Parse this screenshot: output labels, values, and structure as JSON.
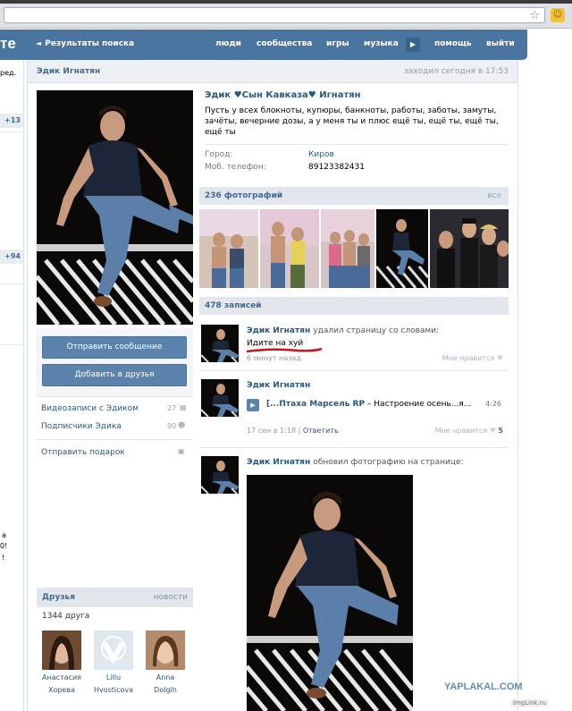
{
  "header": {
    "logo": "те",
    "back_label": "Результаты поиска",
    "nav": [
      "люди",
      "сообщества",
      "игры",
      "музыка",
      "помощь",
      "выйти"
    ]
  },
  "leftcol": {
    "top_text": "ред.",
    "badge1": "+13",
    "badge2": "+94",
    "frag1": "а",
    "frag2": "0!",
    "frag3": "!"
  },
  "profile": {
    "head_name": "Эдик Игнатян",
    "last_seen": "заходил сегодня в 17:53",
    "full_name": "Эдик ♥Сын Кавказа♥ Игнатян",
    "status": "Пусть у всех блокноты, купюры, банкноты, работы, заботы, замуты, зачёты, вечерние дозы, а у меня ты и плюс ещё ты, ещё ты, ещё ты, ещё ты",
    "city_label": "Город:",
    "city_value": "Киров",
    "phone_label": "Моб. телефон:",
    "phone_value": "89123382431"
  },
  "buttons": {
    "message": "Отправить сообщение",
    "add_friend": "Добавить в друзья"
  },
  "menu": {
    "videos": "Видеозаписи с Эдиком",
    "videos_count": "27",
    "subs": "Подписчики Эдика",
    "subs_count": "90",
    "gift": "Отправить подарок"
  },
  "friends": {
    "title": "Друзья",
    "link": "новости",
    "count": "1344 друга",
    "items": [
      {
        "first": "Анастасия",
        "last": "Хорева"
      },
      {
        "first": "Lillu",
        "last": "Hvosticova"
      },
      {
        "first": "Anna",
        "last": "Dolgih"
      }
    ]
  },
  "photos": {
    "title": "236 фотографий",
    "link": "все"
  },
  "wall": {
    "title": "478 записей",
    "posts": [
      {
        "author": "Эдик Игнатян",
        "action": "удалил страницу со словами:",
        "text": "Идите на хуй",
        "time": "6 минут назад",
        "like": "Мне нравится"
      },
      {
        "author": "Эдик Игнатян",
        "audio_title": "[...Птаха Марсель RP",
        "audio_dash": " – Настроение осень...я...",
        "audio_duration": "4:26",
        "time": "17 сен в 1:18",
        "time_sep": " | ",
        "reply": "Ответить",
        "like": "Мне нравится",
        "like_count": "5"
      },
      {
        "author": "Эдик Игнатян",
        "action": "обновил фотографию на странице:"
      }
    ]
  },
  "watermark": {
    "main": "YAPLAKAL.COM",
    "small": "imgLink.ru"
  },
  "colors": {
    "header_bg": "#4a75a0",
    "link": "#2b587a",
    "section_bg": "#e1e7ed",
    "button": "#5c83ab"
  }
}
